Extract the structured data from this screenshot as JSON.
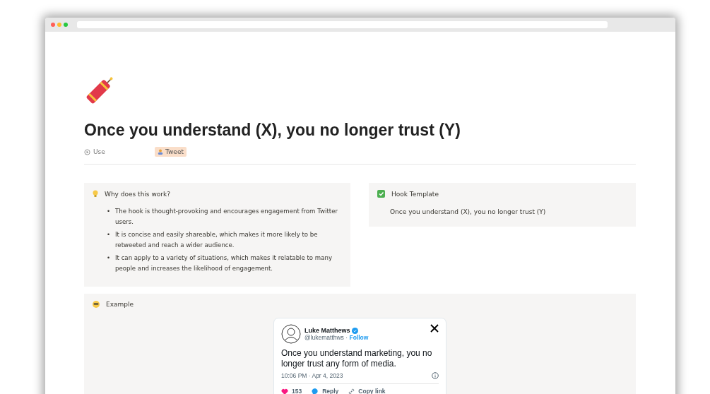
{
  "page": {
    "title": "Once you understand (X), you no longer trust (Y)",
    "properties": [
      {
        "kind": "select",
        "label": "Use"
      },
      {
        "kind": "tag",
        "label": "Tweet"
      }
    ]
  },
  "why": {
    "title": "Why does this work?",
    "marker": "•",
    "bullets": [
      "The hook is thought-provoking and encourages engagement from Twitter users.",
      "It is concise and easily shareable, which makes it more likely to be retweeted and reach a wider audience.",
      "It can apply to a variety of situations, which makes it relatable to many people and increases the likelihood of engagement."
    ]
  },
  "template": {
    "title": "Hook Template",
    "checked": true,
    "text": "Once you understand (X), you no longer trust (Y)"
  },
  "example": {
    "title": "Example",
    "tweet": {
      "name": "Luke Matthews",
      "handle": "@lukematthws",
      "separator": "·",
      "follow": "Follow",
      "text": "Once you understand marketing, you no longer trust any form of media.",
      "time": "10:06 PM · Apr 4, 2023",
      "likes": "153",
      "reply": "Reply",
      "copy": "Copy link"
    }
  }
}
